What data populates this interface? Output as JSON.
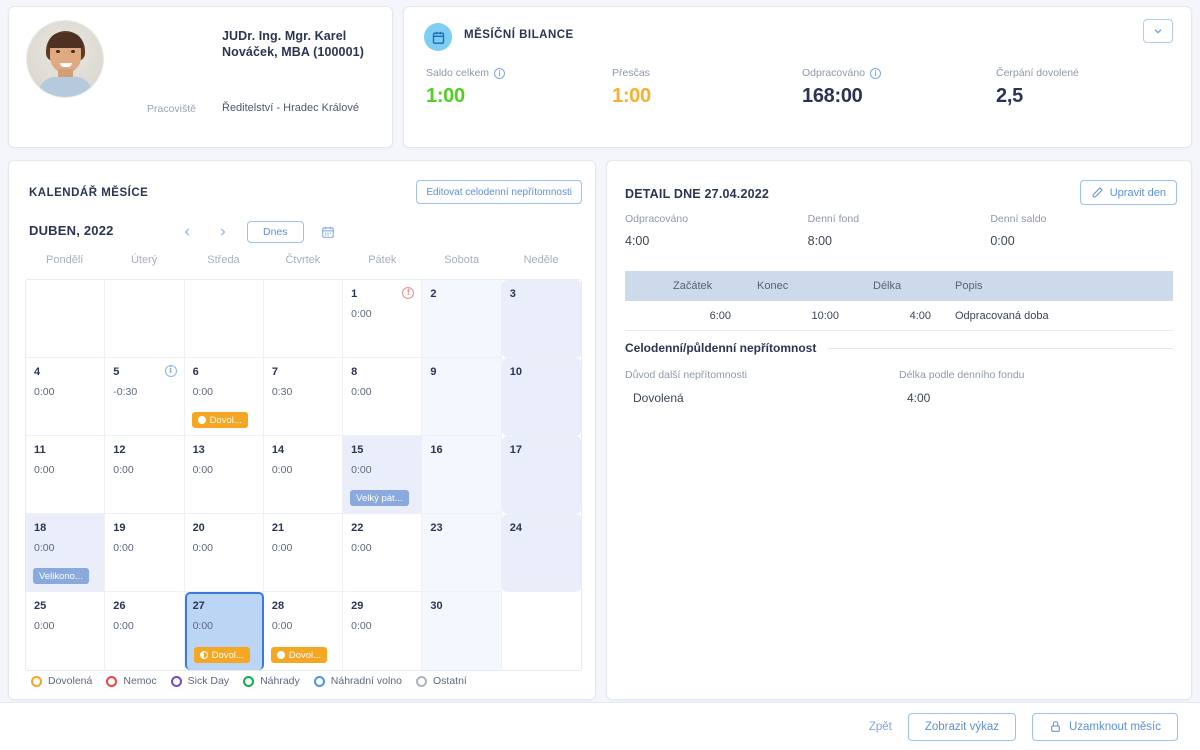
{
  "profile": {
    "name": "JUDr. Ing. Mgr. Karel Nováček, MBA (100001)",
    "workplace_label": "Pracoviště",
    "workplace_value": "Ředitelství - Hradec Králové"
  },
  "balance": {
    "title": "MĚSÍČNÍ BILANCE",
    "toggle_icon": "chevron-down-icon",
    "metrics": [
      {
        "label": "Saldo celkem",
        "value": "1:00",
        "color": "#4fd11f",
        "has_info": true
      },
      {
        "label": "Přesčas",
        "value": "1:00",
        "color": "#fcae2c",
        "has_info": false
      },
      {
        "label": "Odpracováno",
        "value": "168:00",
        "color": "#2b3553",
        "has_info": true
      },
      {
        "label": "Čerpání dovolené",
        "value": "2,5",
        "color": "#2b3553",
        "has_info": false
      }
    ]
  },
  "calendar": {
    "title": "KALENDÁŘ MĚSÍCE",
    "edit_button": "Editovat celodenní nepřítomnosti",
    "month_label": "DUBEN, 2022",
    "prev_icon": "chevron-left-icon",
    "next_icon": "chevron-right-icon",
    "today_button": "Dnes",
    "picker_icon": "calendar-icon",
    "weekdays": [
      "Pondělí",
      "Úterý",
      "Středa",
      "Čtvrtek",
      "Pátek",
      "Sobota",
      "Neděle"
    ],
    "days": [
      {
        "blank": true
      },
      {
        "blank": true
      },
      {
        "blank": true
      },
      {
        "blank": true
      },
      {
        "num": "1",
        "hours": "0:00",
        "icon": "warning",
        "type": "weekday"
      },
      {
        "num": "2",
        "type": "sat"
      },
      {
        "num": "3",
        "type": "sun"
      },
      {
        "num": "4",
        "hours": "0:00",
        "type": "weekday"
      },
      {
        "num": "5",
        "hours": "-0:30",
        "icon": "info",
        "type": "weekday"
      },
      {
        "num": "6",
        "hours": "0:00",
        "type": "weekday",
        "badge": {
          "text": "Dovol...",
          "style": "vac",
          "dot": "full"
        }
      },
      {
        "num": "7",
        "hours": "0:30",
        "type": "weekday"
      },
      {
        "num": "8",
        "hours": "0:00",
        "type": "weekday"
      },
      {
        "num": "9",
        "type": "sat"
      },
      {
        "num": "10",
        "type": "sun"
      },
      {
        "num": "11",
        "hours": "0:00",
        "type": "weekday"
      },
      {
        "num": "12",
        "hours": "0:00",
        "type": "weekday"
      },
      {
        "num": "13",
        "hours": "0:00",
        "type": "weekday"
      },
      {
        "num": "14",
        "hours": "0:00",
        "type": "weekday"
      },
      {
        "num": "15",
        "hours": "0:00",
        "type": "holiday",
        "badge": {
          "text": "Velký pát...",
          "style": "hol",
          "dot": "none"
        }
      },
      {
        "num": "16",
        "type": "sat"
      },
      {
        "num": "17",
        "type": "sun"
      },
      {
        "num": "18",
        "hours": "0:00",
        "type": "holiday",
        "badge": {
          "text": "Velikono...",
          "style": "hol",
          "dot": "none"
        }
      },
      {
        "num": "19",
        "hours": "0:00",
        "type": "weekday"
      },
      {
        "num": "20",
        "hours": "0:00",
        "type": "weekday"
      },
      {
        "num": "21",
        "hours": "0:00",
        "type": "weekday"
      },
      {
        "num": "22",
        "hours": "0:00",
        "type": "weekday"
      },
      {
        "num": "23",
        "type": "sat"
      },
      {
        "num": "24",
        "type": "sun"
      },
      {
        "num": "25",
        "hours": "0:00",
        "type": "weekday"
      },
      {
        "num": "26",
        "hours": "0:00",
        "type": "weekday"
      },
      {
        "num": "27",
        "hours": "0:00",
        "type": "selected",
        "badge": {
          "text": "Dovol...",
          "style": "vac",
          "dot": "half"
        }
      },
      {
        "num": "28",
        "hours": "0:00",
        "type": "weekday",
        "badge": {
          "text": "Dovol...",
          "style": "vac",
          "dot": "full"
        }
      },
      {
        "num": "29",
        "hours": "0:00",
        "type": "weekday"
      },
      {
        "num": "30",
        "type": "sat"
      },
      {
        "blank": true
      }
    ],
    "legend": [
      {
        "label": "Dovolená",
        "color": "#f5a623"
      },
      {
        "label": "Nemoc",
        "color": "#ef4444"
      },
      {
        "label": "Sick Day",
        "color": "#6d4bd8"
      },
      {
        "label": "Náhrady",
        "color": "#0cb04a"
      },
      {
        "label": "Náhradní volno",
        "color": "#4d94f0"
      },
      {
        "label": "Ostatní",
        "color": "#aab3c2"
      }
    ]
  },
  "detail": {
    "title": "DETAIL DNE 27.04.2022",
    "edit_button": "Upravit den",
    "edit_icon": "pencil-icon",
    "stats": [
      {
        "label": "Odpracováno",
        "value": "4:00"
      },
      {
        "label": "Denní fond",
        "value": "8:00"
      },
      {
        "label": "Denní saldo",
        "value": "0:00"
      }
    ],
    "table": {
      "headers": [
        "Začátek",
        "Konec",
        "Délka",
        "Popis"
      ],
      "rows": [
        {
          "start": "6:00",
          "end": "10:00",
          "length": "4:00",
          "desc": "Odpracovaná doba"
        }
      ]
    },
    "absence": {
      "section_title": "Celodenní/půldenní nepřítomnost",
      "reason_label": "Důvod další nepřítomnosti",
      "reason_value": "Dovolená",
      "length_label": "Délka podle denního fondu",
      "length_value": "4:00"
    }
  },
  "footer": {
    "back_link": "Zpět",
    "report_button": "Zobrazit výkaz",
    "lock_button": "Uzamknout měsíc",
    "lock_icon": "lock-icon"
  }
}
